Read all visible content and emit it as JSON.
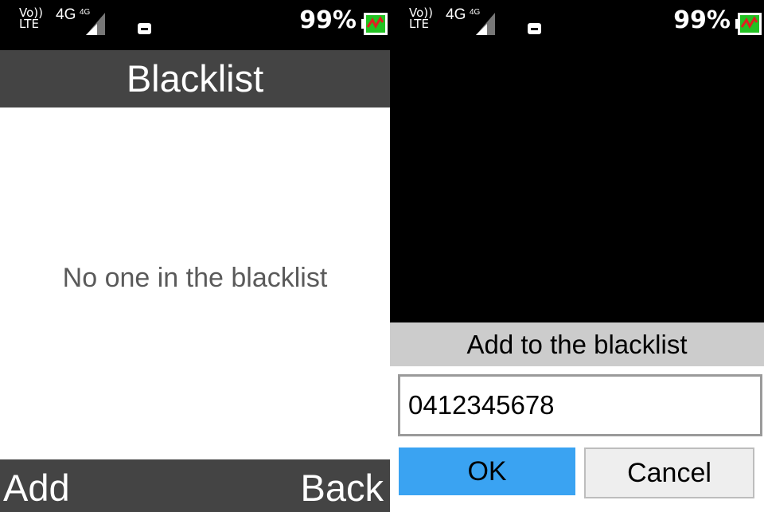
{
  "status": {
    "volte": "Vo)) LTE",
    "network": "4G",
    "signal_badge": "4G",
    "battery_percent": "99%",
    "battery_level": 0.99,
    "battery_color": "#22c222",
    "charging_color": "#e02020",
    "notification_icon": "image-icon"
  },
  "blacklist_screen": {
    "title": "Blacklist",
    "empty_message": "No one in the blacklist",
    "left_softkey": "Add",
    "right_softkey": "Back"
  },
  "add_dialog": {
    "title": "Add to the blacklist",
    "number_value": "0412345678",
    "ok_label": "OK",
    "cancel_label": "Cancel",
    "ok_color": "#3aa3f2"
  }
}
